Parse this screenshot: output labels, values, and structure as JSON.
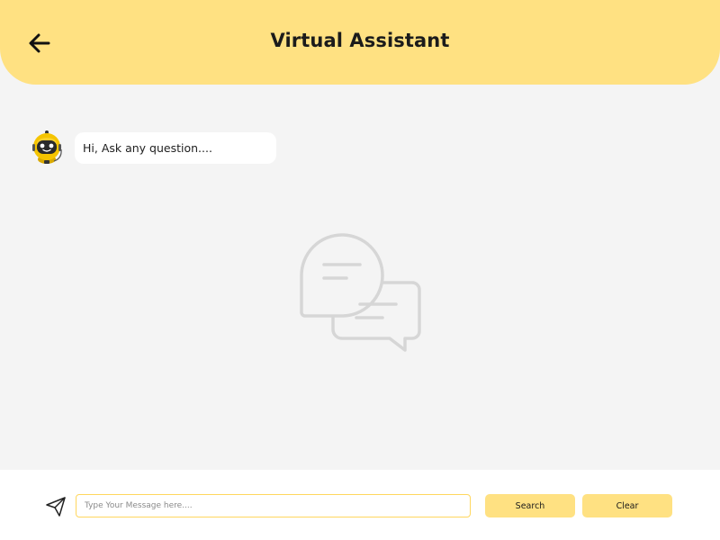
{
  "header": {
    "title": "Virtual Assistant",
    "back_icon": "arrow-left-icon"
  },
  "chat": {
    "bot_avatar_icon": "robot-icon",
    "messages": [
      {
        "sender": "bot",
        "text": "Hi, Ask any question...."
      }
    ],
    "empty_state_icon": "chat-bubbles-icon"
  },
  "composer": {
    "send_icon": "paper-plane-icon",
    "placeholder": "Type Your Message here....",
    "value": "",
    "search_label": "Search",
    "clear_label": "Clear"
  },
  "colors": {
    "accent": "#ffe182",
    "background": "#f4f4f4",
    "input_border": "#ffd75e"
  }
}
